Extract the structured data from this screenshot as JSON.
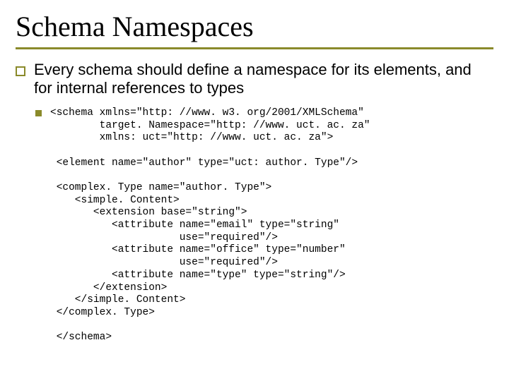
{
  "title": "Schema Namespaces",
  "body": "Every schema should define a namespace for its elements, and for internal references to types",
  "code": "<schema xmlns=\"http: //www. w3. org/2001/XMLSchema\"\n        target. Namespace=\"http: //www. uct. ac. za\"\n        xmlns: uct=\"http: //www. uct. ac. za\">\n\n <element name=\"author\" type=\"uct: author. Type\"/>\n\n <complex. Type name=\"author. Type\">\n    <simple. Content>\n       <extension base=\"string\">\n          <attribute name=\"email\" type=\"string\"\n                     use=\"required\"/>\n          <attribute name=\"office\" type=\"number\"\n                     use=\"required\"/>\n          <attribute name=\"type\" type=\"string\"/>\n       </extension>\n    </simple. Content>\n </complex. Type>\n\n </schema>"
}
